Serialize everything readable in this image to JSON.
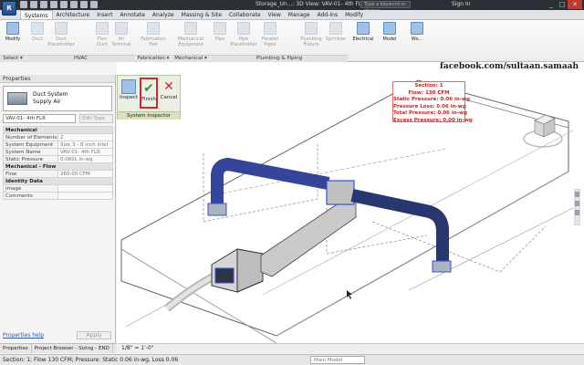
{
  "app": {
    "title": "Storage_Un...: 3D View: VAV-01- 4th FLR",
    "app_button": "R",
    "search_placeholder": "Type a keyword or phrase",
    "signin": "Sign In",
    "window_controls": [
      "_",
      "□",
      "✕"
    ]
  },
  "tabs": [
    "Systems",
    "Architecture",
    "Insert",
    "Annotate",
    "Analyze",
    "Massing & Site",
    "Collaborate",
    "View",
    "Manage",
    "Add-Ins",
    "Modify"
  ],
  "active_tab": "Systems",
  "ribbon": {
    "buttons": [
      {
        "label": "Modify",
        "enabled": true
      },
      {
        "label": "Duct",
        "enabled": false
      },
      {
        "label": "Duct Placeholder",
        "enabled": false
      },
      {
        "label": "Flex Duct",
        "enabled": false
      },
      {
        "label": "Air Terminal",
        "enabled": false
      },
      {
        "label": "Fabrication Part",
        "enabled": false
      },
      {
        "label": "Mechanical Equipment",
        "enabled": false
      },
      {
        "label": "Pipe",
        "enabled": false
      },
      {
        "label": "Pipe Placeholder",
        "enabled": false
      },
      {
        "label": "Parallel Pipes",
        "enabled": false
      },
      {
        "label": "Plumbing Fixture",
        "enabled": false
      },
      {
        "label": "Sprinkler",
        "enabled": false
      },
      {
        "label": "Electrical",
        "enabled": true
      },
      {
        "label": "Model",
        "enabled": true
      },
      {
        "label": "Wo...",
        "enabled": true
      }
    ],
    "groups": [
      "Select ▾",
      "HVAC",
      "Fabrication ▾",
      "Mechanical ▾",
      "Plumbing & Piping"
    ]
  },
  "system_inspector": {
    "buttons": [
      {
        "label": "Inspect",
        "icon": "inspect-icon"
      },
      {
        "label": "Finish",
        "icon": "checkmark-icon"
      },
      {
        "label": "Cancel",
        "icon": "cross-icon"
      }
    ],
    "title": "System Inspector"
  },
  "properties": {
    "title": "Properties",
    "type_name": "Duct System",
    "type_sub": "Supply Air",
    "instance": "VAV-01- 4th FLR",
    "edit_type": "Edit Type",
    "rows": [
      {
        "section": true,
        "label": "Mechanical"
      },
      {
        "label": "Number of Elements",
        "value": "2"
      },
      {
        "label": "System Equipment",
        "value": "Size 3 - 8 inch Inlet"
      },
      {
        "label": "System Name",
        "value": "VAV-01- 4th FLR"
      },
      {
        "label": "Static Pressure",
        "value": "0.060L in-wg"
      },
      {
        "section": true,
        "label": "Mechanical - Flow"
      },
      {
        "label": "Flow",
        "value": "260.00 CFM"
      },
      {
        "section": true,
        "label": "Identity Data"
      },
      {
        "label": "Image",
        "value": ""
      },
      {
        "label": "Comments",
        "value": ""
      }
    ],
    "help_link": "Properties help",
    "apply": "Apply"
  },
  "panel_tabs": [
    "Properties",
    "Project Browser - Sizing - END"
  ],
  "section_tag": {
    "lines": [
      "Section: 1",
      "Flow: 130 CFM",
      "Static Pressure: 0.06 in-wg",
      "Pressure Loss: 0.06 in-wg",
      "Total Pressure: 0.06 in-wg",
      "Excess Pressure: 0.00 in-wg"
    ]
  },
  "watermark": "facebook.com/sultaan.samaah",
  "view_scale": "1/8\" = 1'-0\"",
  "status": {
    "text": "Section: 1; Flow 130 CFM; Pressure: Static 0.06 in-wg, Loss 0.06",
    "model": "Main Model"
  },
  "colors": {
    "title_bar": "#2b2f36",
    "duct_highlight": "#3a4fd0",
    "alert_red": "#d01f1f"
  }
}
